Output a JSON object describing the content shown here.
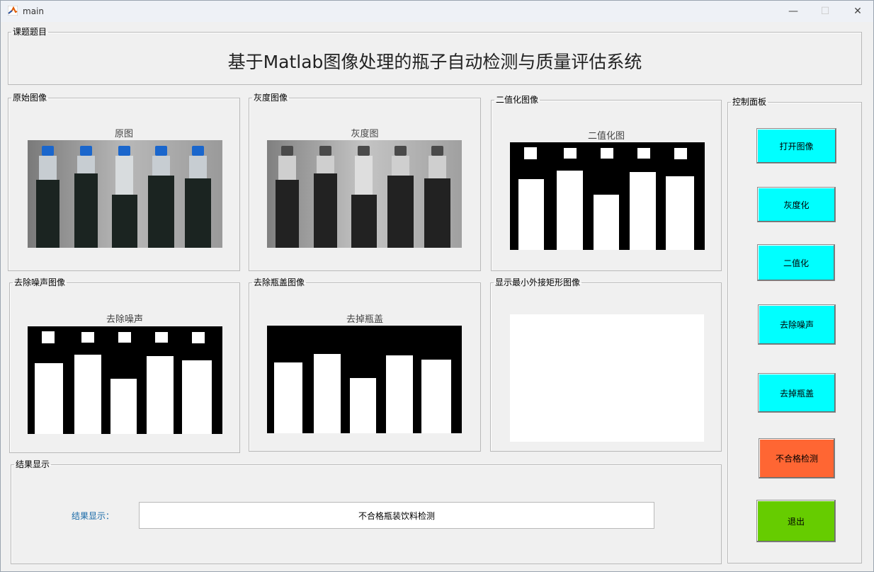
{
  "window": {
    "title": "main",
    "minimize": "—",
    "maximize": "☐",
    "close": "✕"
  },
  "header": {
    "panel_title": "课题题目",
    "heading": "基于Matlab图像处理的瓶子自动检测与质量评估系统"
  },
  "panels": {
    "original": {
      "title": "原始图像",
      "axes_title": "原图"
    },
    "gray": {
      "title": "灰度图像",
      "axes_title": "灰度图"
    },
    "binary": {
      "title": "二值化图像",
      "axes_title": "二值化图"
    },
    "denoise": {
      "title": "去除噪声图像",
      "axes_title": "去除噪声"
    },
    "capremove": {
      "title": "去除瓶盖图像",
      "axes_title": "去掉瓶盖"
    },
    "bbox": {
      "title": "显示最小外接矩形图像"
    }
  },
  "control": {
    "title": "控制面板",
    "buttons": [
      {
        "label": "打开图像",
        "color": "#00ffff"
      },
      {
        "label": "灰度化",
        "color": "#00ffff"
      },
      {
        "label": "二值化",
        "color": "#00ffff"
      },
      {
        "label": "去除噪声",
        "color": "#00ffff"
      },
      {
        "label": "去掉瓶盖",
        "color": "#00ffff"
      },
      {
        "label": "不合格检测",
        "color": "#ff6633"
      },
      {
        "label": "退出",
        "color": "#66cc00"
      }
    ]
  },
  "result": {
    "panel_title": "结果显示",
    "label": "结果显示：",
    "value": "不合格瓶装饮料检测"
  }
}
